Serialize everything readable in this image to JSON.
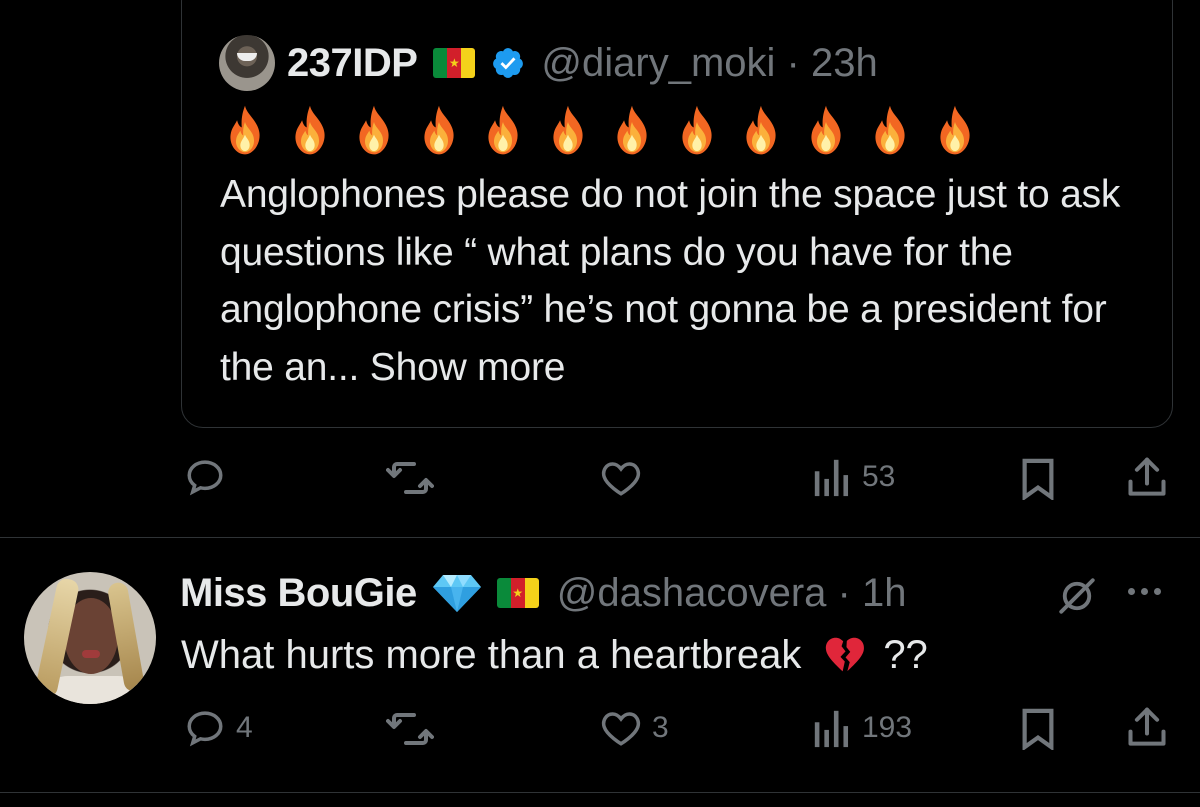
{
  "quoted_tweet": {
    "display_name": "237IDP",
    "handle": "@diary_moki",
    "time": "23h",
    "handle_time": "@diary_moki · 23h",
    "flag_icon": "cameroon-flag-icon",
    "verified_icon": "verified-badge-icon",
    "emoji_row": [
      "🔥",
      "🔥",
      "🔥",
      "🔥",
      "🔥",
      "🔥",
      "🔥",
      "🔥",
      "🔥",
      "🔥",
      "🔥",
      "🔥"
    ],
    "text": "Anglophones please do not join the space just to ask questions like “ what plans do you have for the anglophone crisis” he’s not gonna be a president for the an...",
    "show_more": "Show more"
  },
  "quoted_actions": {
    "reply": "",
    "repost": "",
    "like": "",
    "views": "53"
  },
  "tweet": {
    "display_name": "Miss BouGie",
    "handle_time": "@dashacovera · 1h",
    "handle": "@dashacovera",
    "time": "1h",
    "gem_icon": "gem-emoji-icon",
    "flag_icon": "cameroon-flag-icon",
    "text": "What hurts more than a heartbreak",
    "emoji": "💔",
    "text_suffix": "??"
  },
  "tweet_actions": {
    "reply": "4",
    "repost": "",
    "like": "3",
    "views": "193"
  },
  "colors": {
    "background": "#000000",
    "text": "#e7e9ea",
    "muted": "#71767b",
    "border": "#2f3336",
    "verified": "#1d9bf0",
    "fire_orange": "#f7941d"
  }
}
